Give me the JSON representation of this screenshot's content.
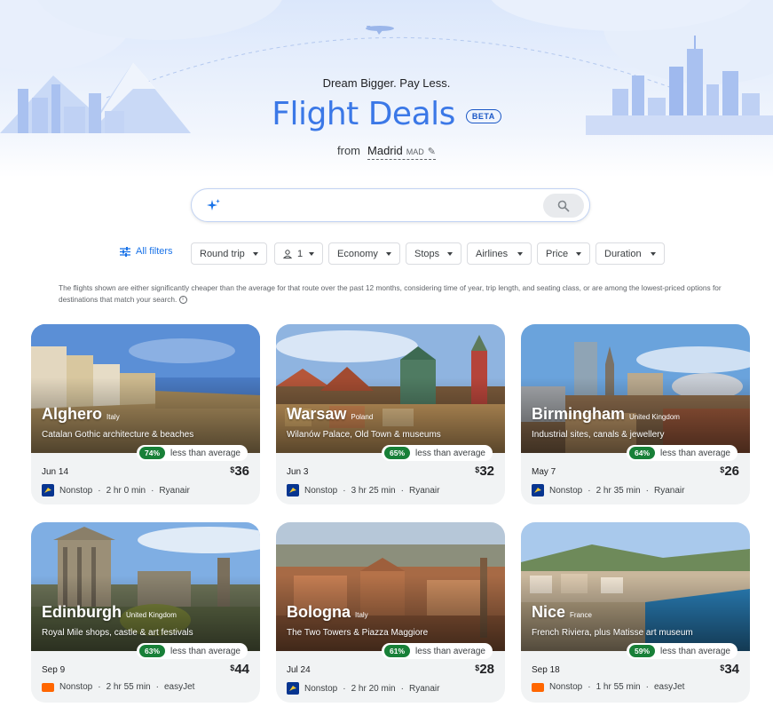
{
  "hero": {
    "tagline": "Dream Bigger. Pay Less.",
    "title": "Flight Deals",
    "badge": "BETA",
    "from_label": "from",
    "origin_city": "Madrid",
    "origin_code": "MAD",
    "edit_icon": "pencil-icon"
  },
  "search": {
    "placeholder": "",
    "icon": "sparkle-icon",
    "button_icon": "search-icon"
  },
  "filters": {
    "all_filters_label": "All filters",
    "all_filters_icon": "tune-icon",
    "trip_type": "Round trip",
    "passengers": "1",
    "passenger_icon": "person-icon",
    "cabin": "Economy",
    "stops": "Stops",
    "airlines": "Airlines",
    "price": "Price",
    "duration": "Duration"
  },
  "disclaimer": "The flights shown are either significantly cheaper than the average for that route over the past 12 months, considering time of year, trip length, and seating class, or are among the lowest-priced options for destinations that match your search.",
  "deals": [
    {
      "city": "Alghero",
      "country": "Italy",
      "description": "Catalan Gothic architecture & beaches",
      "discount": "74%",
      "discount_label": "less than average",
      "date": "Jun 14",
      "currency": "$",
      "price": "36",
      "stops": "Nonstop",
      "duration": "2 hr 0 min",
      "airline": "Ryanair",
      "airline_logo": "ryanair-logo"
    },
    {
      "city": "Warsaw",
      "country": "Poland",
      "description": "Wilanów Palace, Old Town & museums",
      "discount": "65%",
      "discount_label": "less than average",
      "date": "Jun 3",
      "currency": "$",
      "price": "32",
      "stops": "Nonstop",
      "duration": "3 hr 25 min",
      "airline": "Ryanair",
      "airline_logo": "ryanair-logo"
    },
    {
      "city": "Birmingham",
      "country": "United Kingdom",
      "description": "Industrial sites, canals & jewellery",
      "discount": "64%",
      "discount_label": "less than average",
      "date": "May 7",
      "currency": "$",
      "price": "26",
      "stops": "Nonstop",
      "duration": "2 hr 35 min",
      "airline": "Ryanair",
      "airline_logo": "ryanair-logo"
    },
    {
      "city": "Edinburgh",
      "country": "United Kingdom",
      "description": "Royal Mile shops, castle & art festivals",
      "discount": "63%",
      "discount_label": "less than average",
      "date": "Sep 9",
      "currency": "$",
      "price": "44",
      "stops": "Nonstop",
      "duration": "2 hr 55 min",
      "airline": "easyJet",
      "airline_logo": "easyjet-logo"
    },
    {
      "city": "Bologna",
      "country": "Italy",
      "description": "The Two Towers & Piazza Maggiore",
      "discount": "61%",
      "discount_label": "less than average",
      "date": "Jul 24",
      "currency": "$",
      "price": "28",
      "stops": "Nonstop",
      "duration": "2 hr 20 min",
      "airline": "Ryanair",
      "airline_logo": "ryanair-logo"
    },
    {
      "city": "Nice",
      "country": "France",
      "description": "French Riviera, plus Matisse art museum",
      "discount": "59%",
      "discount_label": "less than average",
      "date": "Sep 18",
      "currency": "$",
      "price": "34",
      "stops": "Nonstop",
      "duration": "1 hr 55 min",
      "airline": "easyJet",
      "airline_logo": "easyjet-logo"
    }
  ],
  "colors": {
    "accent": "#3b78e7",
    "badge_green": "#188038",
    "card_bg": "#f1f3f4",
    "hero_sky": "#dce8fb"
  }
}
